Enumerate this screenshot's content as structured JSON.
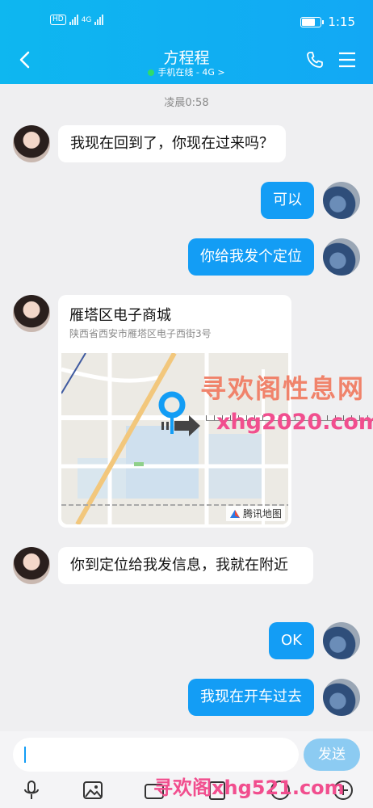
{
  "status_bar": {
    "hd": "HD",
    "net": "4G",
    "time": "1:15",
    "battery_level": 0.75
  },
  "header": {
    "title": "方程程",
    "status": "手机在线 - 4G",
    "status_chevron": ">"
  },
  "timestamp": "凌晨0:58",
  "messages": [
    {
      "from": "her",
      "text": "我现在回到了，你现在过来吗？"
    },
    {
      "from": "me",
      "text": "可以"
    },
    {
      "from": "me",
      "text": "你给我发个定位"
    },
    {
      "from": "her",
      "type": "location",
      "title": "雁塔区电子商城",
      "address": "陕西省西安市雁塔区电子西街3号",
      "map_provider": "腾讯地图"
    },
    {
      "from": "her",
      "text": "你到定位给我发信息，我就在附近"
    },
    {
      "from": "me",
      "text": "OK"
    },
    {
      "from": "me",
      "text": "我现在开车过去"
    }
  ],
  "input": {
    "placeholder": "",
    "send_label": "发送"
  },
  "watermarks": {
    "top_cn": "寻欢阁性息网",
    "top_url": "xhg2020.com",
    "bottom": "寻欢阁xhg521.com"
  },
  "colors": {
    "header": "#12a8f4",
    "out_bubble": "#139df5",
    "send_btn": "#8ccbf2"
  }
}
